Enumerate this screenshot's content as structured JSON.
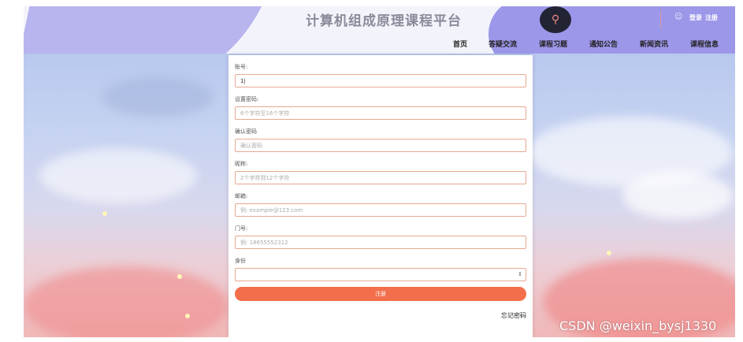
{
  "header": {
    "title": "计算机组成原理课程平台",
    "auth": {
      "login": "登录",
      "register": "注册"
    }
  },
  "nav": [
    {
      "label": "首页"
    },
    {
      "label": "答疑交流"
    },
    {
      "label": "课程习题"
    },
    {
      "label": "通知公告"
    },
    {
      "label": "新闻资讯"
    },
    {
      "label": "课程信息"
    }
  ],
  "form": {
    "account": {
      "label": "账号:",
      "value": "1|"
    },
    "password": {
      "label": "设置密码:",
      "placeholder": "6个字符至16个字符"
    },
    "confirm": {
      "label": "确认密码",
      "placeholder": "确认密码"
    },
    "nickname": {
      "label": "昵称:",
      "placeholder": "2个字符到12个字符"
    },
    "email": {
      "label": "邮箱:",
      "placeholder": "例: example@123.com"
    },
    "phone": {
      "label": "门号:",
      "placeholder": "例: 18655552312"
    },
    "identity": {
      "label": "身份",
      "value": ""
    },
    "submit_label": "注册",
    "forgot_label": "忘记密码"
  },
  "watermark": "CSDN @weixin_bysj1330",
  "colors": {
    "accent": "#f36f4b",
    "header_blob": "#9d97ea",
    "field_border": "#e8a992"
  },
  "icons": {
    "search": "search-icon",
    "user": "user-icon",
    "select_arrows": "chevron-updown-icon"
  }
}
